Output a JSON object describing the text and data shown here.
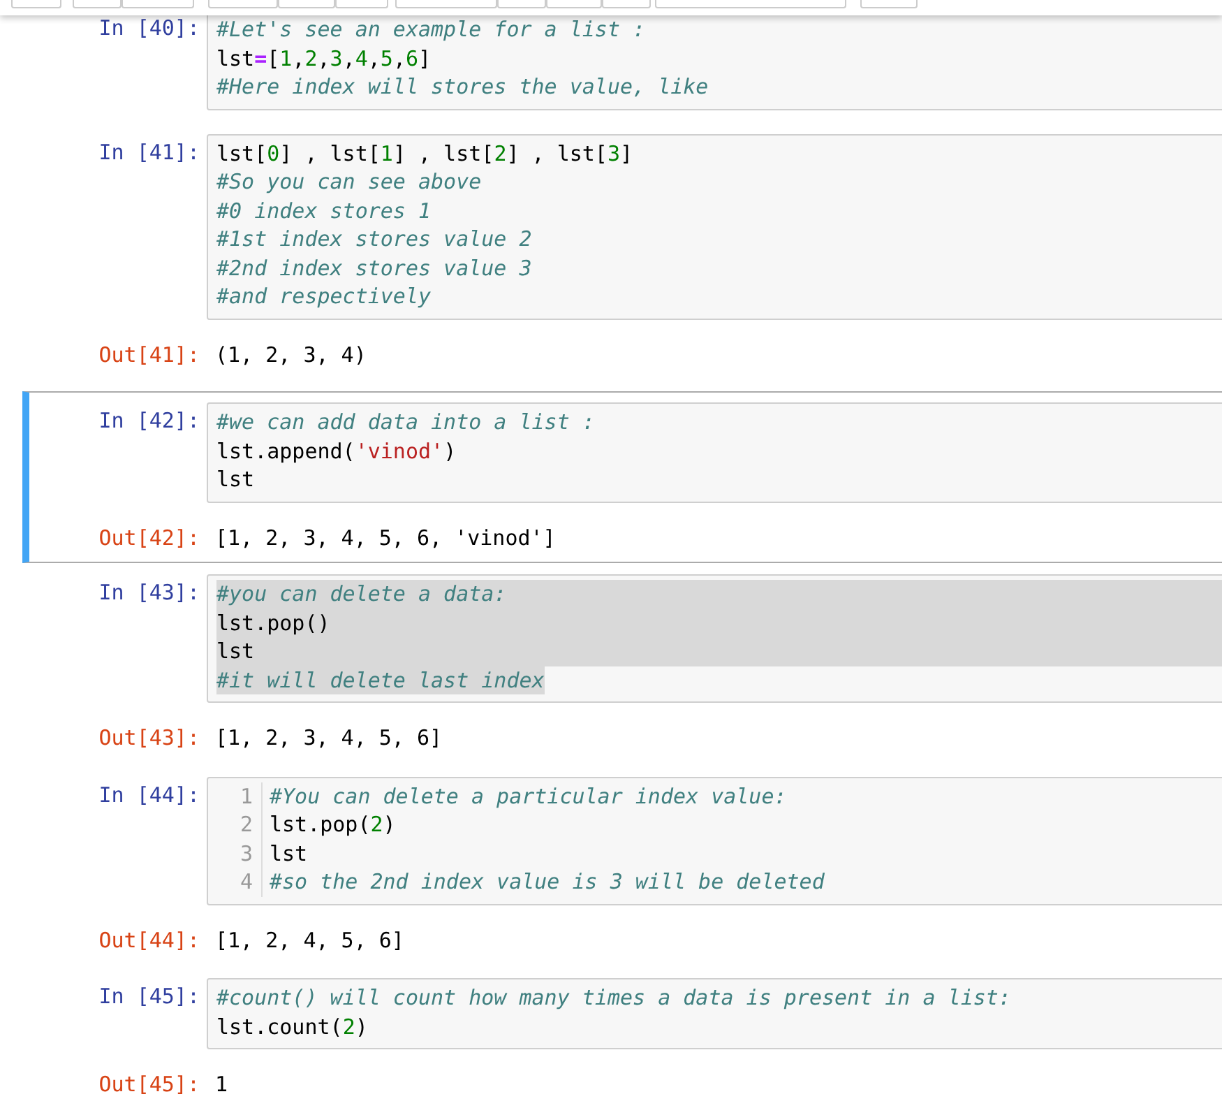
{
  "toolbar": {
    "buttons": [
      {
        "kind": "button"
      },
      {
        "kind": "button"
      },
      {
        "kind": "button"
      },
      {
        "kind": "button"
      },
      {
        "kind": "button"
      },
      {
        "kind": "button"
      },
      {
        "kind": "button"
      },
      {
        "kind": "button"
      },
      {
        "kind": "button"
      },
      {
        "kind": "button"
      },
      {
        "kind": "dropdown"
      },
      {
        "kind": "button"
      }
    ]
  },
  "cells": [
    {
      "prompt": "In [40]:",
      "selected": false,
      "line_numbers": false,
      "lines": [
        {
          "tokens": [
            {
              "kind": "comment",
              "text": "#Let's see an example for a list :"
            }
          ]
        },
        {
          "tokens": [
            {
              "kind": "name",
              "text": "lst"
            },
            {
              "kind": "op",
              "text": "="
            },
            {
              "kind": "name",
              "text": "["
            },
            {
              "kind": "number",
              "text": "1"
            },
            {
              "kind": "name",
              "text": ","
            },
            {
              "kind": "number",
              "text": "2"
            },
            {
              "kind": "name",
              "text": ","
            },
            {
              "kind": "number",
              "text": "3"
            },
            {
              "kind": "name",
              "text": ","
            },
            {
              "kind": "number",
              "text": "4"
            },
            {
              "kind": "name",
              "text": ","
            },
            {
              "kind": "number",
              "text": "5"
            },
            {
              "kind": "name",
              "text": ","
            },
            {
              "kind": "number",
              "text": "6"
            },
            {
              "kind": "name",
              "text": "]"
            }
          ]
        },
        {
          "tokens": [
            {
              "kind": "comment",
              "text": "#Here index will stores the value, like"
            }
          ]
        }
      ]
    },
    {
      "prompt": "In [41]:",
      "selected": false,
      "line_numbers": false,
      "lines": [
        {
          "tokens": [
            {
              "kind": "name",
              "text": "lst["
            },
            {
              "kind": "number",
              "text": "0"
            },
            {
              "kind": "name",
              "text": "] , lst["
            },
            {
              "kind": "number",
              "text": "1"
            },
            {
              "kind": "name",
              "text": "] , lst["
            },
            {
              "kind": "number",
              "text": "2"
            },
            {
              "kind": "name",
              "text": "] , lst["
            },
            {
              "kind": "number",
              "text": "3"
            },
            {
              "kind": "name",
              "text": "]"
            }
          ]
        },
        {
          "tokens": [
            {
              "kind": "comment",
              "text": "#So you can see above"
            }
          ]
        },
        {
          "tokens": [
            {
              "kind": "comment",
              "text": "#0 index stores 1"
            }
          ]
        },
        {
          "tokens": [
            {
              "kind": "comment",
              "text": "#1st index stores value 2"
            }
          ]
        },
        {
          "tokens": [
            {
              "kind": "comment",
              "text": "#2nd index stores value 3"
            }
          ]
        },
        {
          "tokens": [
            {
              "kind": "comment",
              "text": "#and respectively"
            }
          ]
        }
      ],
      "output": {
        "prompt": "Out[41]:",
        "text": "(1, 2, 3, 4)"
      }
    },
    {
      "prompt": "In [42]:",
      "selected": true,
      "line_numbers": false,
      "lines": [
        {
          "tokens": [
            {
              "kind": "comment",
              "text": "#we can add data into a list :"
            }
          ]
        },
        {
          "tokens": [
            {
              "kind": "name",
              "text": "lst.append("
            },
            {
              "kind": "string",
              "text": "'vinod'"
            },
            {
              "kind": "name",
              "text": ")"
            }
          ]
        },
        {
          "tokens": [
            {
              "kind": "name",
              "text": "lst"
            }
          ]
        }
      ],
      "output": {
        "prompt": "Out[42]:",
        "text": "[1, 2, 3, 4, 5, 6, 'vinod']"
      }
    },
    {
      "prompt": "In [43]:",
      "selected": false,
      "line_numbers": false,
      "lines": [
        {
          "highlighted": true,
          "tokens": [
            {
              "kind": "comment",
              "text": "#you can delete a data:"
            }
          ]
        },
        {
          "highlighted": true,
          "tokens": [
            {
              "kind": "name",
              "text": "lst.pop()"
            }
          ]
        },
        {
          "highlighted": true,
          "tokens": [
            {
              "kind": "name",
              "text": "lst"
            }
          ]
        },
        {
          "highlighted": true,
          "tokens": [
            {
              "kind": "comment",
              "text": "#it will delete last index"
            }
          ]
        }
      ],
      "output": {
        "prompt": "Out[43]:",
        "text": "[1, 2, 3, 4, 5, 6]"
      }
    },
    {
      "prompt": "In [44]:",
      "selected": false,
      "line_numbers": true,
      "lines": [
        {
          "number": "1",
          "tokens": [
            {
              "kind": "comment",
              "text": "#You can delete a particular index value:"
            }
          ]
        },
        {
          "number": "2",
          "tokens": [
            {
              "kind": "name",
              "text": "lst.pop("
            },
            {
              "kind": "number",
              "text": "2"
            },
            {
              "kind": "name",
              "text": ")"
            }
          ]
        },
        {
          "number": "3",
          "tokens": [
            {
              "kind": "name",
              "text": "lst"
            }
          ]
        },
        {
          "number": "4",
          "tokens": [
            {
              "kind": "comment",
              "text": "#so the 2nd index value is 3 will be deleted"
            }
          ]
        }
      ],
      "output": {
        "prompt": "Out[44]:",
        "text": "[1, 2, 4, 5, 6]"
      }
    },
    {
      "prompt": "In [45]:",
      "selected": false,
      "line_numbers": false,
      "lines": [
        {
          "tokens": [
            {
              "kind": "comment",
              "text": "#count() will count how many times a data is present in a list:"
            }
          ]
        },
        {
          "tokens": [
            {
              "kind": "name",
              "text": "lst.count("
            },
            {
              "kind": "number",
              "text": "2"
            },
            {
              "kind": "name",
              "text": ")"
            }
          ]
        }
      ],
      "output": {
        "prompt": "Out[45]:",
        "text": "1"
      }
    }
  ]
}
